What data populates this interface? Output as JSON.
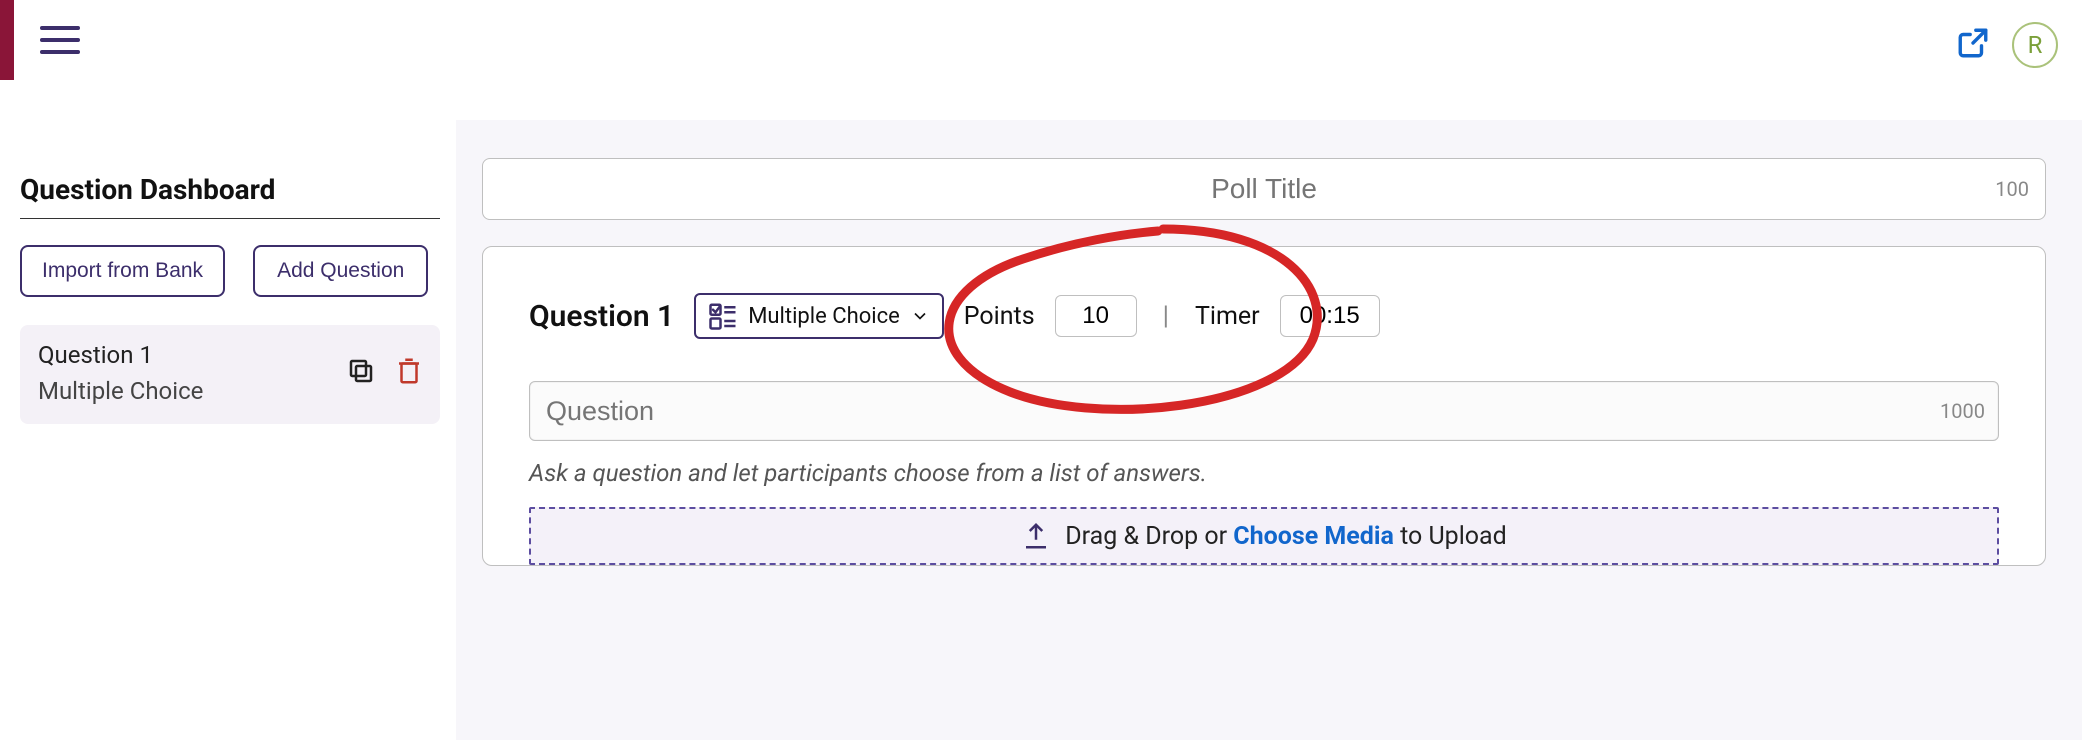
{
  "header": {
    "avatar_initial": "R"
  },
  "sidebar": {
    "title": "Question Dashboard",
    "import_btn": "Import from Bank",
    "add_btn": "Add Question",
    "items": [
      {
        "title": "Question 1",
        "subtitle": "Multiple Choice"
      }
    ]
  },
  "editor": {
    "poll_title_placeholder": "Poll Title",
    "poll_title_maxlen": "100",
    "question_label": "Question 1",
    "qtype_label": "Multiple Choice",
    "points_label": "Points",
    "points_value": "10",
    "timer_label": "Timer",
    "timer_value": "00:15",
    "question_placeholder": "Question",
    "question_maxlen": "1000",
    "helper_text": "Ask a question and let participants choose from a list of answers.",
    "upload_pre": "Drag & Drop or ",
    "upload_link": "Choose Media",
    "upload_post": " to Upload"
  },
  "colors": {
    "accent": "#3c2e6b",
    "link": "#1166cc",
    "danger": "#c0392b",
    "annotation": "#d62626"
  }
}
